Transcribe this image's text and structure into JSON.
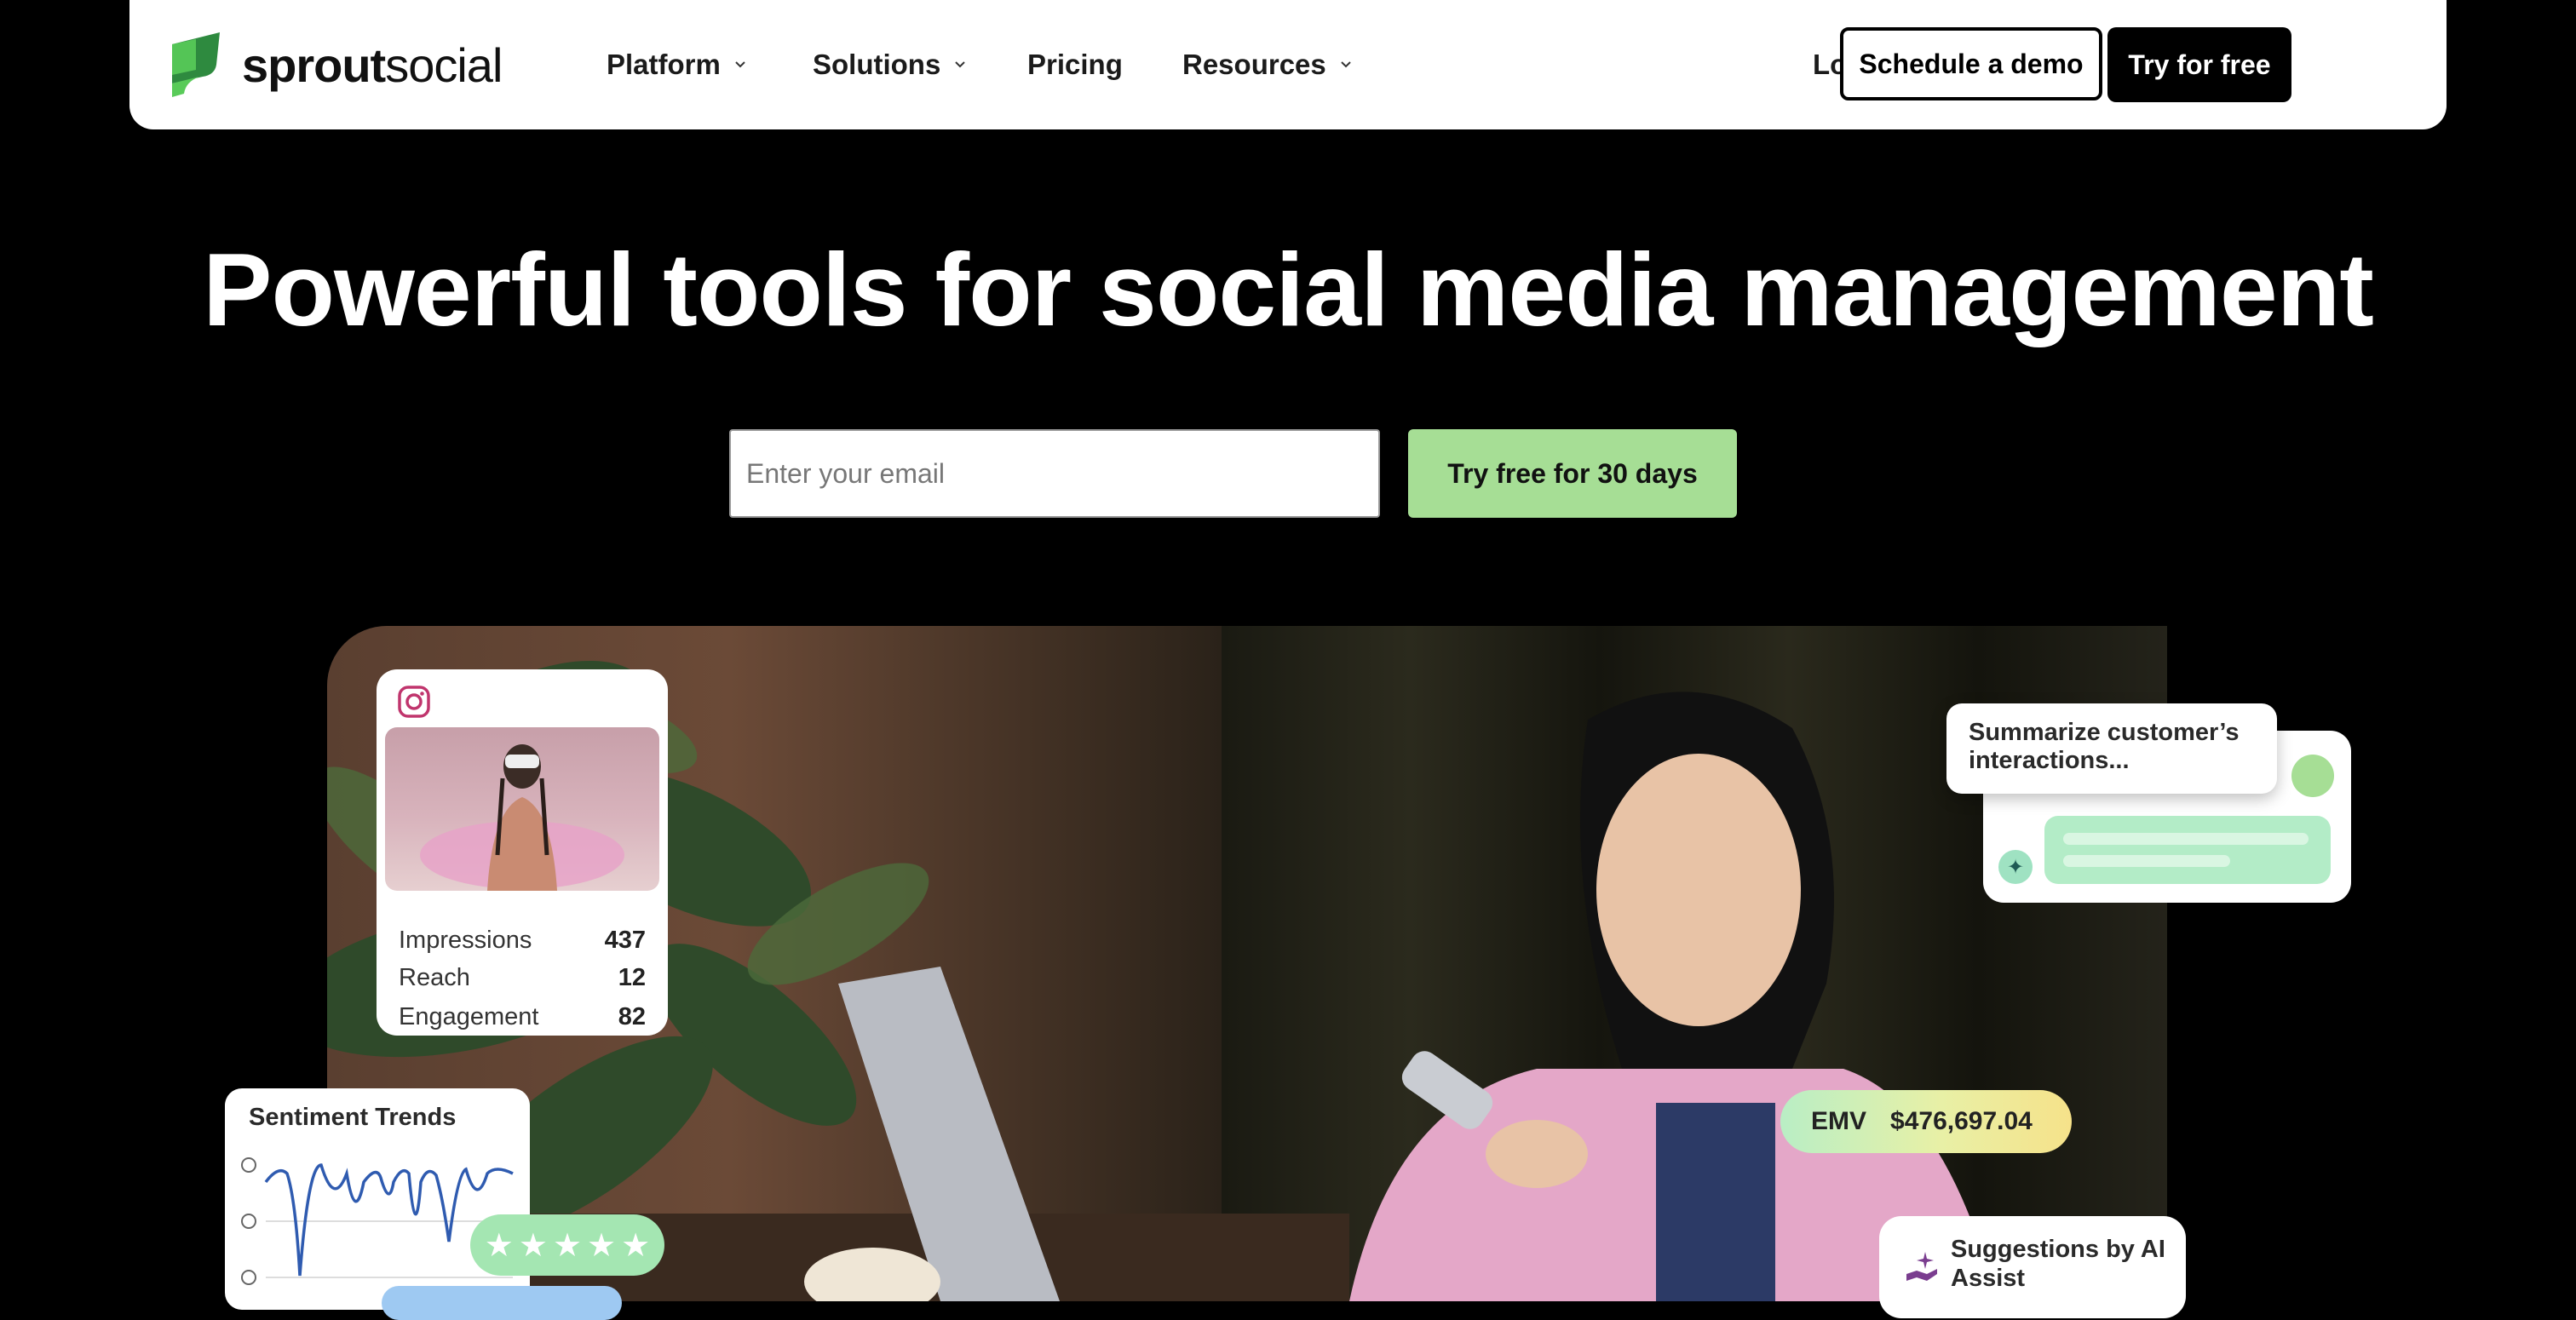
{
  "header": {
    "logo_text_bold": "sprout",
    "logo_text_light": "social",
    "nav": [
      {
        "label": "Platform",
        "has_dropdown": true
      },
      {
        "label": "Solutions",
        "has_dropdown": true
      },
      {
        "label": "Pricing",
        "has_dropdown": false
      },
      {
        "label": "Resources",
        "has_dropdown": true
      }
    ],
    "login": "Log in",
    "schedule_demo": "Schedule a demo",
    "try_free": "Try for free"
  },
  "hero": {
    "title": "Powerful tools for social media management",
    "email_placeholder": "Enter your email",
    "cta": "Try free for 30 days"
  },
  "cards": {
    "instagram": {
      "stats": [
        {
          "label": "Impressions",
          "value": "437"
        },
        {
          "label": "Reach",
          "value": "12"
        },
        {
          "label": "Engagement",
          "value": "82"
        }
      ]
    },
    "sentiment": {
      "title": "Sentiment Trends",
      "rating_stars": 5
    },
    "ai_prompt": "Summarize customer’s interactions...",
    "emv": {
      "label": "EMV",
      "value": "$476,697.04"
    },
    "suggestions": "Suggestions by AI Assist"
  },
  "colors": {
    "brand_green": "#59cb59",
    "cta_green": "#a6de95",
    "background": "#000000"
  }
}
